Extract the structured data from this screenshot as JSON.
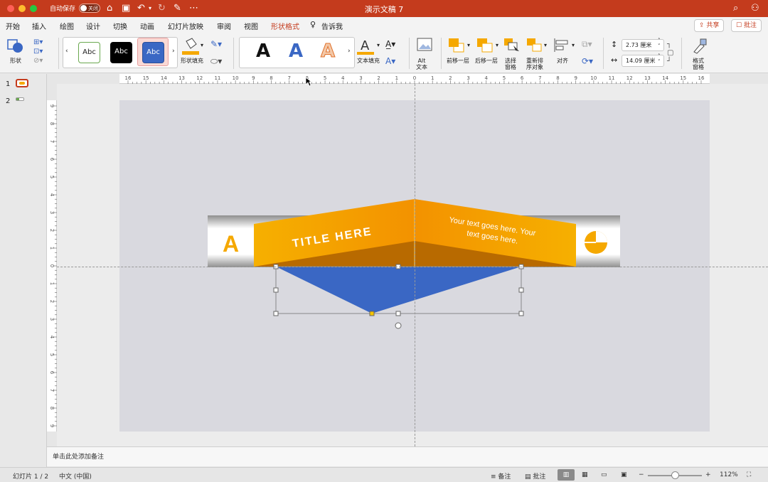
{
  "window": {
    "title": "演示文稿 7",
    "autosave_label": "自动保存",
    "autosave_state": "关闭"
  },
  "tabs": [
    {
      "label": "开始"
    },
    {
      "label": "插入"
    },
    {
      "label": "绘图"
    },
    {
      "label": "设计"
    },
    {
      "label": "切换"
    },
    {
      "label": "动画"
    },
    {
      "label": "幻灯片放映"
    },
    {
      "label": "审阅"
    },
    {
      "label": "视图"
    },
    {
      "label": "形状格式",
      "active": true
    },
    {
      "label": "告诉我"
    }
  ],
  "top_buttons": {
    "share": "共享",
    "comment": "批注"
  },
  "ribbon": {
    "shape_label": "形状",
    "style_samples": [
      "Abc",
      "Abc",
      "Abc"
    ],
    "shape_fill_label": "形状填充",
    "wordart_letters": [
      "A",
      "A",
      "A"
    ],
    "text_fill_label": "文本填充",
    "alt_text_label": "Alt\n文本",
    "bring_forward": "前移一层",
    "send_backward": "后移一层",
    "selection_pane": "选择\n窗格",
    "reorder": "重新排\n序对象",
    "align": "对齐",
    "height_value": "2.73 厘米",
    "width_value": "14.09 厘米",
    "format_pane": "格式\n窗格"
  },
  "ruler": {
    "labels": [
      "16",
      "15",
      "14",
      "13",
      "12",
      "11",
      "10",
      "9",
      "8",
      "7",
      "6",
      "5",
      "4",
      "3",
      "2",
      "1",
      "0",
      "1",
      "2",
      "3",
      "4",
      "5",
      "6",
      "7",
      "8",
      "9",
      "10",
      "11",
      "12",
      "13",
      "14",
      "15",
      "16"
    ]
  },
  "vruler": {
    "labels": [
      "9",
      "8",
      "7",
      "6",
      "5",
      "4",
      "3",
      "2",
      "1",
      "0",
      "1",
      "2",
      "3",
      "4",
      "5",
      "6",
      "7",
      "8",
      "9"
    ]
  },
  "thumbnails": [
    {
      "number": "1",
      "selected": true
    },
    {
      "number": "2"
    }
  ],
  "slide": {
    "title_text": "TITLE HERE",
    "body_text": [
      "Your text goes here. Your",
      "text goes here."
    ],
    "left_icon_letter": "A",
    "colors": {
      "orange": "#f5a800",
      "dark_orange": "#b86a00",
      "blue": "#3a67c4",
      "brand_red": "#c43b1d"
    }
  },
  "notes_placeholder": "单击此处添加备注",
  "status": {
    "slide_counter": "幻灯片 1 / 2",
    "language": "中文 (中国)",
    "notes_button": "备注",
    "comments_button": "批注",
    "zoom": "112%"
  }
}
